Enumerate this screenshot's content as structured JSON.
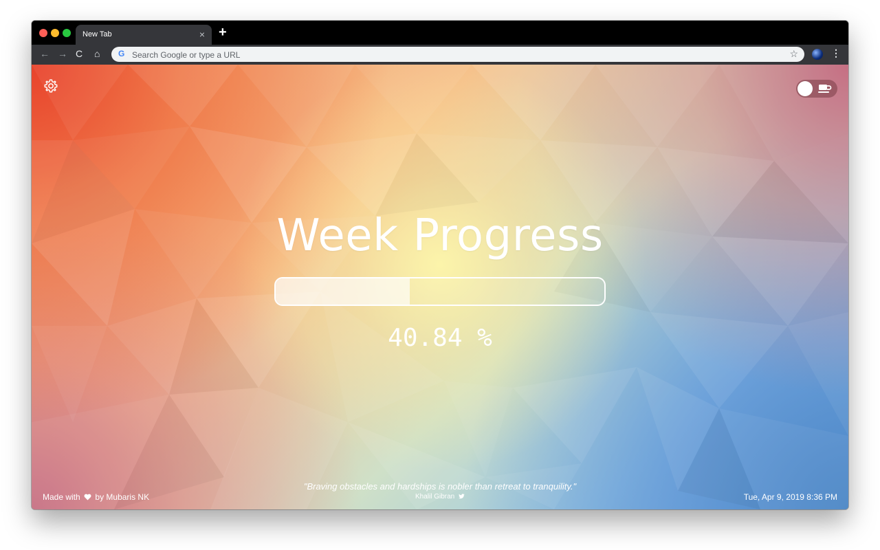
{
  "browser": {
    "tab_title": "New Tab",
    "tab_close": "×",
    "new_tab": "+",
    "nav": {
      "back": "←",
      "forward": "→",
      "reload": "C",
      "home": "⌂"
    },
    "omnibox": {
      "placeholder": "Search Google or type a URL",
      "value": "",
      "g": "G"
    },
    "star": "☆",
    "menu": "⋮"
  },
  "page": {
    "title": "Week Progress",
    "progress_percent": 40.84,
    "percent_label": "40.84 %",
    "credit": {
      "prefix": "Made with",
      "suffix": "by Mubaris NK"
    },
    "quote": "\"Braving obstacles and hardships is nobler than retreat to tranquility.\"",
    "quote_author": "Khalil Gibran",
    "datetime": "Tue, Apr 9, 2019 8:36 PM"
  },
  "icons": {
    "settings": "gear-icon",
    "toggle": "coffee-icon",
    "heart": "heart-icon",
    "twitter": "twitter-icon"
  },
  "colors": {
    "titlebar": "#000000",
    "toolbar": "#35363a",
    "omnibox": "#f1f3f4",
    "text_on_background": "#ffffff"
  }
}
